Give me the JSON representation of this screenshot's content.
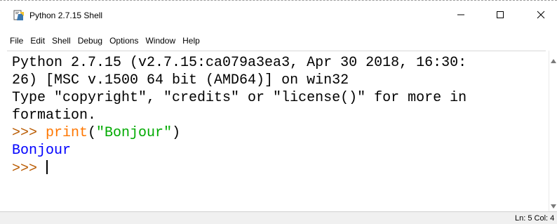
{
  "window": {
    "title": "Python 2.7.15 Shell"
  },
  "titlebar": {
    "icons": {
      "app": "python-idle-icon",
      "minimize": "minimize-icon",
      "maximize": "maximize-icon",
      "close": "close-icon"
    }
  },
  "menu": {
    "items": [
      "File",
      "Edit",
      "Shell",
      "Debug",
      "Options",
      "Window",
      "Help"
    ]
  },
  "shell": {
    "banner_line1": "Python 2.7.15 (v2.7.15:ca079a3ea3, Apr 30 2018, 16:30:",
    "banner_line2": "26) [MSC v.1500 64 bit (AMD64)] on win32",
    "banner_line3": "Type \"copyright\", \"credits\" or \"license()\" for more in",
    "banner_line4": "formation.",
    "prompt": ">>> ",
    "cmd_keyword": "print",
    "cmd_open": "(",
    "cmd_string": "\"Bonjour\"",
    "cmd_close": ")",
    "output": "Bonjour",
    "prompt2": ">>> "
  },
  "colors": {
    "prompt": "#b95a00",
    "keyword": "#ff7700",
    "string": "#00aa00",
    "output": "#0000ff"
  },
  "status": {
    "text": "Ln: 5  Col: 4"
  }
}
